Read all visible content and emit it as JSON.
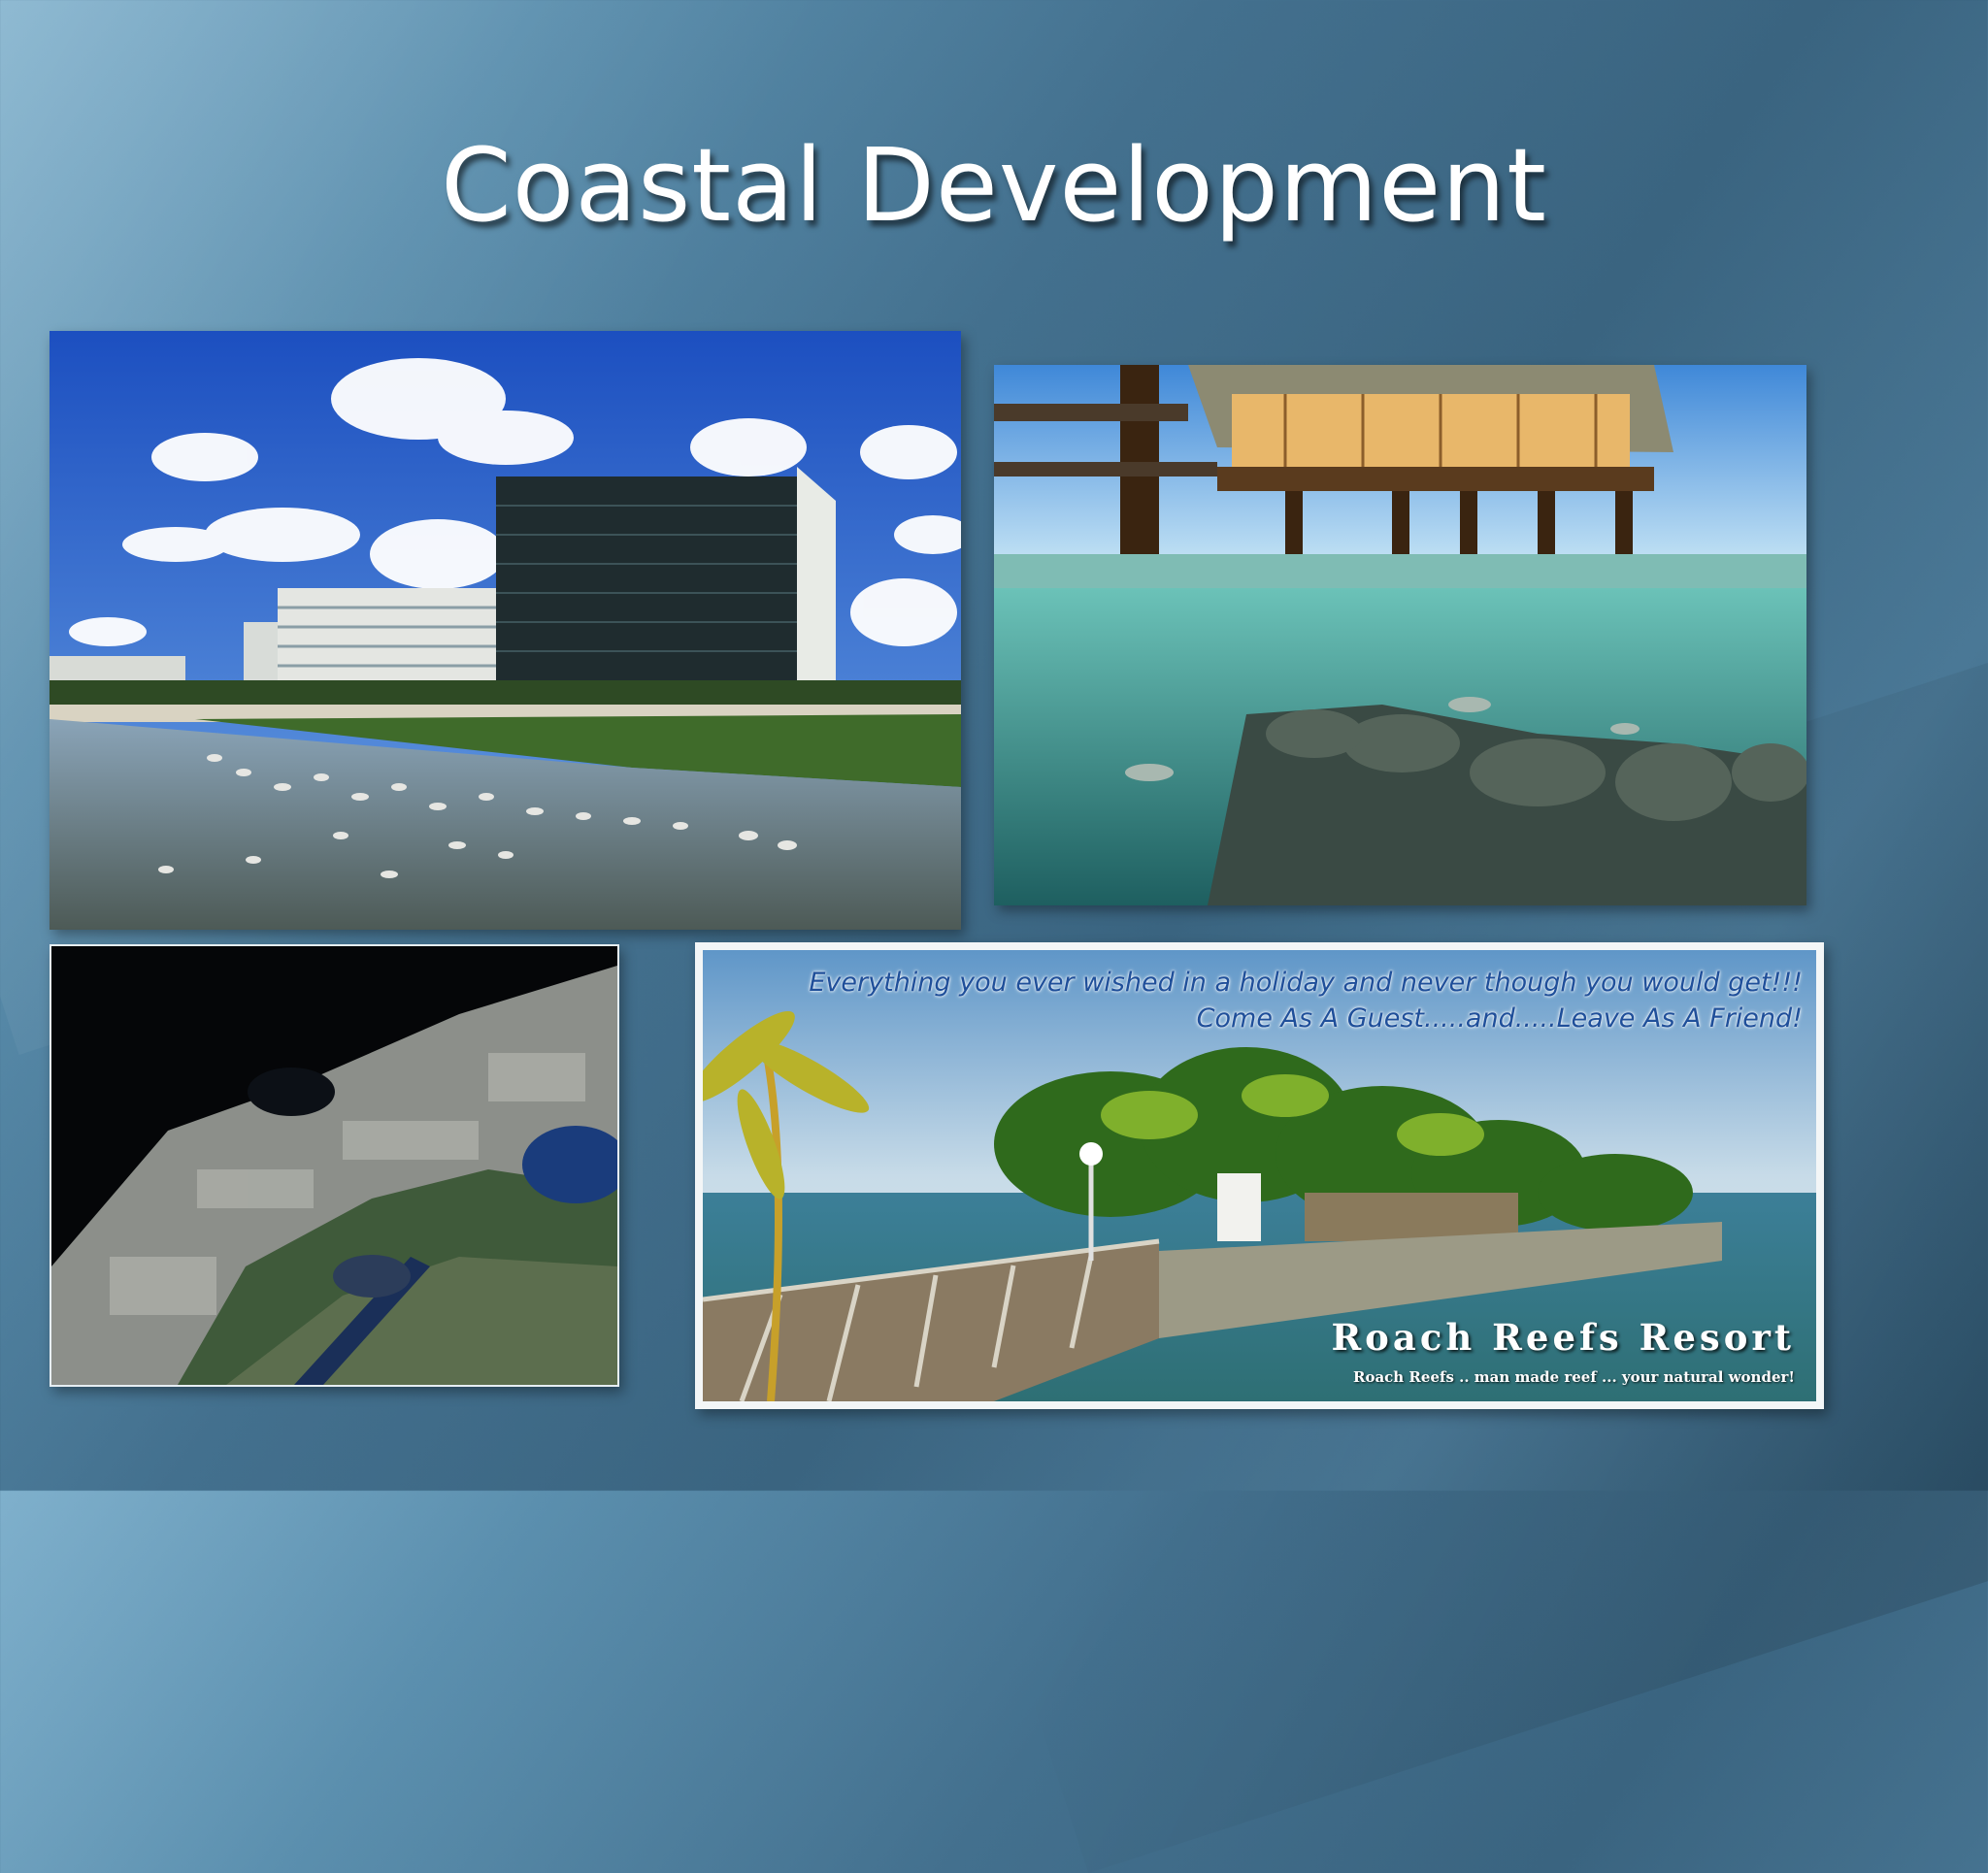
{
  "slide": {
    "title": "Coastal Development"
  },
  "images": {
    "beach_condos": {
      "icon": "beach-condominiums-photo"
    },
    "overwater_bungalows": {
      "icon": "overwater-bungalows-reef-photo"
    },
    "satellite_coastline": {
      "icon": "satellite-coastline-photo"
    },
    "resort_ad": {
      "icon": "resort-island-photo",
      "caption_line1": "Everything you ever wished in a holiday and never though you would get!!!",
      "caption_line2": "Come As A Guest.....and.....Leave As A Friend!",
      "resort_name": "Roach Reefs Resort",
      "tagline": "Roach Reefs .. man made reef ... your natural wonder!"
    }
  },
  "colors": {
    "background": "#43708e",
    "title": "#ffffff",
    "caption": "#1f4f9a"
  }
}
